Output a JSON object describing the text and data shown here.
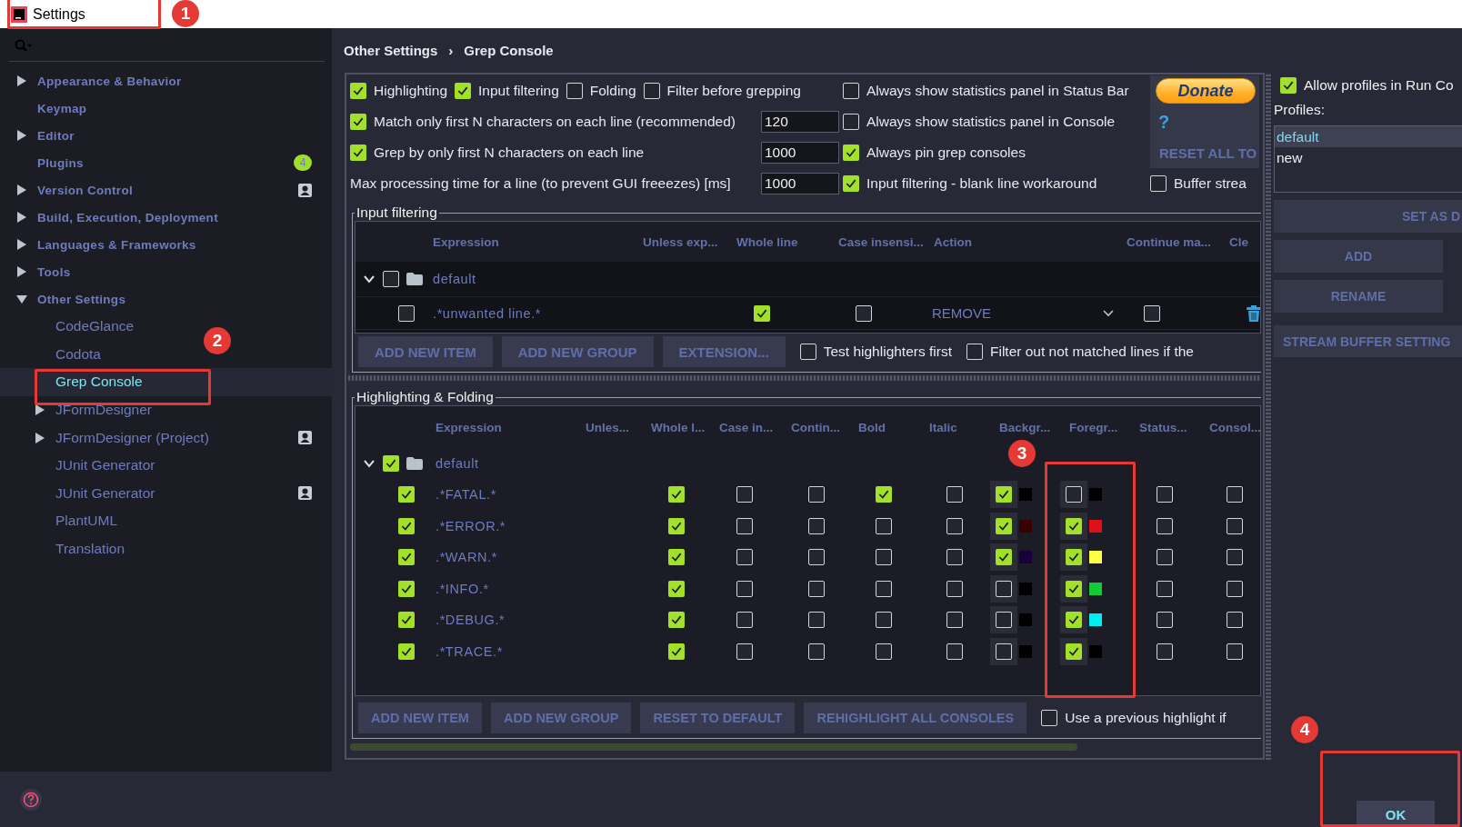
{
  "window": {
    "title": "Settings"
  },
  "sidebar": {
    "items": [
      {
        "label": "Appearance & Behavior",
        "expanded": false,
        "selected": false,
        "project": false
      },
      {
        "label": "Keymap",
        "selected": false,
        "project": false
      },
      {
        "label": "Editor",
        "expanded": false,
        "selected": false,
        "project": false
      },
      {
        "label": "Plugins",
        "badge": "4",
        "selected": false,
        "project": false
      },
      {
        "label": "Version Control",
        "expanded": false,
        "selected": false,
        "project": true
      },
      {
        "label": "Build, Execution, Deployment",
        "expanded": false,
        "selected": false,
        "project": false
      },
      {
        "label": "Languages & Frameworks",
        "expanded": false,
        "selected": false,
        "project": false
      },
      {
        "label": "Tools",
        "expanded": false,
        "selected": false,
        "project": false
      },
      {
        "label": "Other Settings",
        "expanded": true,
        "selected": false,
        "project": false,
        "children": [
          {
            "label": "CodeGlance",
            "selected": false,
            "project": false
          },
          {
            "label": "Codota",
            "selected": false,
            "project": false
          },
          {
            "label": "Grep Console",
            "selected": true,
            "project": false
          },
          {
            "label": "JFormDesigner",
            "expanded": false,
            "selected": false,
            "project": false
          },
          {
            "label": "JFormDesigner (Project)",
            "expanded": false,
            "selected": false,
            "project": true
          },
          {
            "label": "JUnit Generator",
            "selected": false,
            "project": false
          },
          {
            "label": "JUnit Generator",
            "selected": false,
            "project": true
          },
          {
            "label": "PlantUML",
            "selected": false,
            "project": false
          },
          {
            "label": "Translation",
            "selected": false,
            "project": false
          }
        ]
      }
    ]
  },
  "breadcrumb": {
    "items": [
      "Other Settings",
      "Grep Console"
    ],
    "separator": "›"
  },
  "options": {
    "rows": [
      [
        {
          "kind": "group",
          "items": [
            {
              "label": "Highlighting",
              "checked": true
            },
            {
              "label": "Input filtering",
              "checked": true
            },
            {
              "label": "Folding",
              "checked": false
            },
            {
              "label": "Filter before grepping",
              "checked": false
            }
          ]
        },
        "",
        {
          "kind": "checkbox",
          "label": "Always show statistics panel in Status Bar",
          "checked": false
        },
        {
          "kind": "donate",
          "label": "Donate"
        }
      ],
      [
        {
          "kind": "checkbox",
          "label": "Match only first N characters on each line (recommended)",
          "checked": true
        },
        {
          "kind": "field",
          "value": "120"
        },
        {
          "kind": "checkbox",
          "label": "Always show statistics panel in Console",
          "checked": false
        },
        {
          "kind": "help",
          "label": "?"
        }
      ],
      [
        {
          "kind": "checkbox",
          "label": "Grep by only first N characters on each line",
          "checked": true
        },
        {
          "kind": "field",
          "value": "1000"
        },
        {
          "kind": "checkbox",
          "label": "Always pin grep consoles",
          "checked": true
        },
        {
          "kind": "button",
          "label": "RESET ALL TO"
        }
      ],
      [
        {
          "kind": "label",
          "label": "Max processing time for a line (to prevent GUI freeezes) [ms]"
        },
        {
          "kind": "field",
          "value": "1000"
        },
        {
          "kind": "checkbox",
          "label": "Input filtering - blank line workaround",
          "checked": true
        },
        {
          "kind": "checkbox",
          "label": "Buffer strea",
          "checked": false
        }
      ]
    ]
  },
  "input_filtering": {
    "title": "Input filtering",
    "columns": [
      "Expression",
      "Unless exp...",
      "Whole line",
      "Case insensi...",
      "Action",
      "Continue ma...",
      "Cle"
    ],
    "groups": [
      {
        "name": "default",
        "expanded": true,
        "checked": false,
        "items": [
          {
            "checked": false,
            "expression": ".*unwanted line.*",
            "whole_line": true,
            "case_insensitive": false,
            "action": "REMOVE",
            "continue_matching": false
          }
        ]
      }
    ],
    "buttons": [
      "ADD NEW ITEM",
      "ADD NEW GROUP",
      "EXTENSION..."
    ],
    "options": [
      {
        "label": "Test highlighters first",
        "checked": false
      },
      {
        "label": "Filter out not matched lines if the",
        "checked": false
      }
    ]
  },
  "highlighting": {
    "title": "Highlighting & Folding",
    "columns": [
      "Expression",
      "Unles...",
      "Whole l...",
      "Case in...",
      "Contin...",
      "Bold",
      "Italic",
      "Backgr...",
      "Foregr...",
      "Status...",
      "Consol..."
    ],
    "groups": [
      {
        "name": "default",
        "expanded": true,
        "checked": true,
        "items": [
          {
            "checked": true,
            "expression": ".*FATAL.*",
            "whole_line": true,
            "case_insensitive": false,
            "continue_matching": false,
            "bold": true,
            "italic": false,
            "background": {
              "checked": true,
              "color": "#000000"
            },
            "foreground": {
              "checked": false,
              "color": "#000000"
            },
            "status_bar": false,
            "console_count": false
          },
          {
            "checked": true,
            "expression": ".*ERROR.*",
            "whole_line": true,
            "case_insensitive": false,
            "continue_matching": false,
            "bold": false,
            "italic": false,
            "background": {
              "checked": true,
              "color": "#3a0000"
            },
            "foreground": {
              "checked": true,
              "color": "#e0101a"
            },
            "status_bar": false,
            "console_count": false
          },
          {
            "checked": true,
            "expression": ".*WARN.*",
            "whole_line": true,
            "case_insensitive": false,
            "continue_matching": false,
            "bold": false,
            "italic": false,
            "background": {
              "checked": true,
              "color": "#1a0038"
            },
            "foreground": {
              "checked": true,
              "color": "#ffff44"
            },
            "status_bar": false,
            "console_count": false
          },
          {
            "checked": true,
            "expression": ".*INFO.*",
            "whole_line": true,
            "case_insensitive": false,
            "continue_matching": false,
            "bold": false,
            "italic": false,
            "background": {
              "checked": false,
              "color": "#000000"
            },
            "foreground": {
              "checked": true,
              "color": "#11cc33"
            },
            "status_bar": false,
            "console_count": false
          },
          {
            "checked": true,
            "expression": ".*DEBUG.*",
            "whole_line": true,
            "case_insensitive": false,
            "continue_matching": false,
            "bold": false,
            "italic": false,
            "background": {
              "checked": false,
              "color": "#000000"
            },
            "foreground": {
              "checked": true,
              "color": "#00eeee"
            },
            "status_bar": false,
            "console_count": false
          },
          {
            "checked": true,
            "expression": ".*TRACE.*",
            "whole_line": true,
            "case_insensitive": false,
            "continue_matching": false,
            "bold": false,
            "italic": false,
            "background": {
              "checked": false,
              "color": "#000000"
            },
            "foreground": {
              "checked": true,
              "color": "#000000"
            },
            "status_bar": false,
            "console_count": false
          }
        ]
      }
    ],
    "buttons": [
      "ADD NEW ITEM",
      "ADD NEW GROUP",
      "RESET TO DEFAULT",
      "REHIGHLIGHT ALL CONSOLES"
    ],
    "options": [
      {
        "label": "Use a previous highlight if",
        "checked": false
      }
    ]
  },
  "profiles_panel": {
    "allow": {
      "label": "Allow profiles in Run Co",
      "checked": true
    },
    "profiles_label": "Profiles:",
    "profiles": [
      {
        "name": "default",
        "selected": true
      },
      {
        "name": "new",
        "selected": false
      }
    ],
    "buttons": [
      {
        "label": "SET AS D",
        "kind": "right"
      },
      {
        "label": "ADD",
        "kind": "half"
      },
      {
        "label": "RENAME",
        "kind": "half"
      },
      {
        "label": "STREAM BUFFER SETTING",
        "kind": "left"
      }
    ]
  },
  "footer": {
    "ok": "OK"
  },
  "annotations": [
    {
      "number": "1"
    },
    {
      "number": "2"
    },
    {
      "number": "3"
    },
    {
      "number": "4"
    }
  ]
}
